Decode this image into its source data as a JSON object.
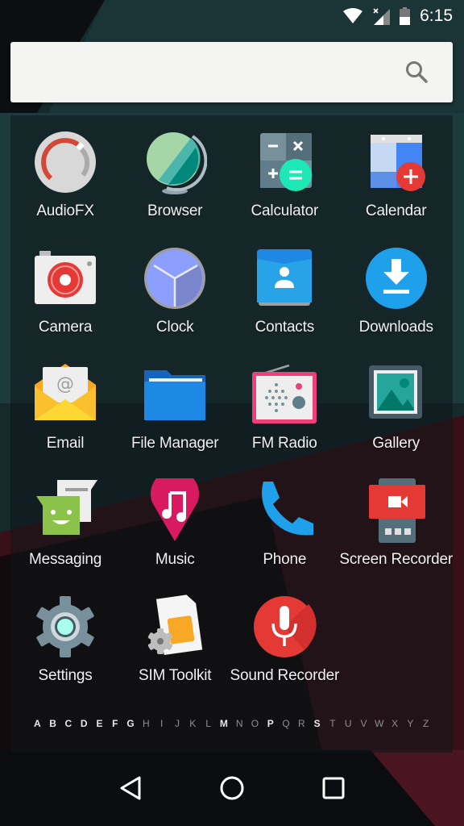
{
  "status_bar": {
    "time": "6:15",
    "icons": [
      "wifi-icon",
      "cell-signal-no-data-icon",
      "battery-icon"
    ]
  },
  "search": {
    "placeholder": "",
    "icon": "search-icon"
  },
  "apps": [
    {
      "label": "AudioFX",
      "icon": "audiofx-icon"
    },
    {
      "label": "Browser",
      "icon": "browser-icon"
    },
    {
      "label": "Calculator",
      "icon": "calculator-icon"
    },
    {
      "label": "Calendar",
      "icon": "calendar-icon"
    },
    {
      "label": "Camera",
      "icon": "camera-icon"
    },
    {
      "label": "Clock",
      "icon": "clock-icon"
    },
    {
      "label": "Contacts",
      "icon": "contacts-icon"
    },
    {
      "label": "Downloads",
      "icon": "downloads-icon"
    },
    {
      "label": "Email",
      "icon": "email-icon"
    },
    {
      "label": "File Manager",
      "icon": "file-manager-icon"
    },
    {
      "label": "FM Radio",
      "icon": "fm-radio-icon"
    },
    {
      "label": "Gallery",
      "icon": "gallery-icon"
    },
    {
      "label": "Messaging",
      "icon": "messaging-icon"
    },
    {
      "label": "Music",
      "icon": "music-icon"
    },
    {
      "label": "Phone",
      "icon": "phone-icon"
    },
    {
      "label": "Screen Recorder",
      "icon": "screen-recorder-icon"
    },
    {
      "label": "Settings",
      "icon": "settings-icon"
    },
    {
      "label": "SIM Toolkit",
      "icon": "sim-toolkit-icon"
    },
    {
      "label": "Sound Recorder",
      "icon": "sound-recorder-icon"
    }
  ],
  "alphabet": {
    "letters": [
      "A",
      "B",
      "C",
      "D",
      "E",
      "F",
      "G",
      "H",
      "I",
      "J",
      "K",
      "L",
      "M",
      "N",
      "O",
      "P",
      "Q",
      "R",
      "S",
      "T",
      "U",
      "V",
      "W",
      "X",
      "Y",
      "Z"
    ],
    "active": [
      "A",
      "B",
      "C",
      "D",
      "E",
      "F",
      "G",
      "M",
      "P",
      "S"
    ]
  },
  "navbar": {
    "buttons": [
      "back",
      "home",
      "recents"
    ]
  }
}
